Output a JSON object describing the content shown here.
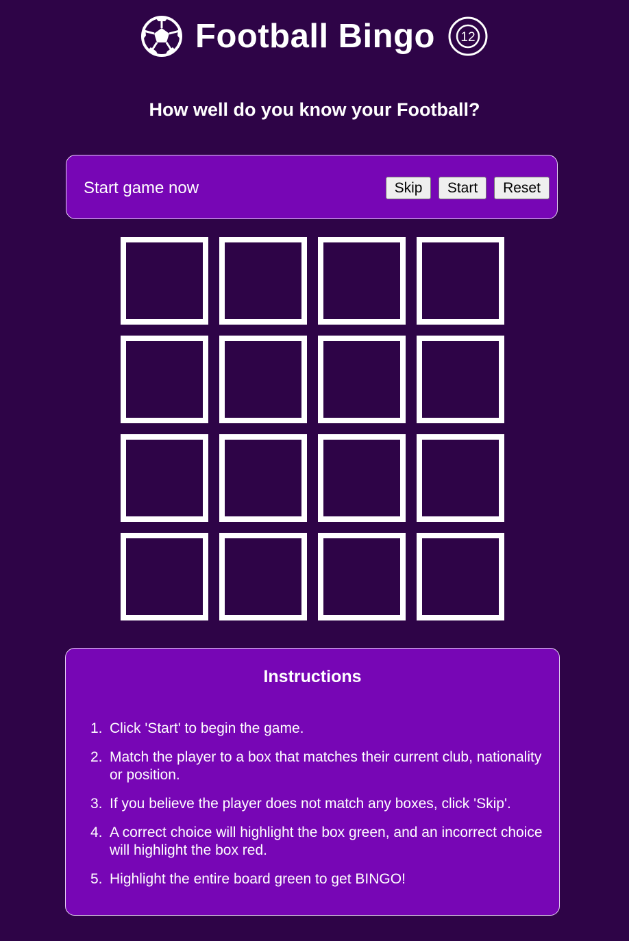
{
  "header": {
    "title": "Football Bingo",
    "left_icon": "soccer-ball-icon",
    "right_icon": "number-12-badge-icon",
    "badge_number": "12"
  },
  "subtitle": "How well do you know your Football?",
  "controls": {
    "status_text": "Start game now",
    "skip_label": "Skip",
    "start_label": "Start",
    "reset_label": "Reset"
  },
  "board": {
    "rows": 4,
    "columns": 4,
    "cells": [
      "",
      "",
      "",
      "",
      "",
      "",
      "",
      "",
      "",
      "",
      "",
      "",
      "",
      "",
      "",
      ""
    ]
  },
  "instructions": {
    "title": "Instructions",
    "steps": [
      {
        "num": "1.",
        "text": "Click 'Start' to begin the game."
      },
      {
        "num": "2.",
        "text": "Match the player to a box that matches their current club, nationality or position."
      },
      {
        "num": "3.",
        "text": "If you believe the player does not match any boxes, click 'Skip'."
      },
      {
        "num": "4.",
        "text": "A correct choice will highlight the box green, and an incorrect choice will highlight the box red."
      },
      {
        "num": "5.",
        "text": "Highlight the entire board green to get BINGO!"
      }
    ]
  },
  "colors": {
    "background": "#2e0447",
    "panel": "#7706b5",
    "cell_border": "#ffffff",
    "text": "#ffffff"
  }
}
